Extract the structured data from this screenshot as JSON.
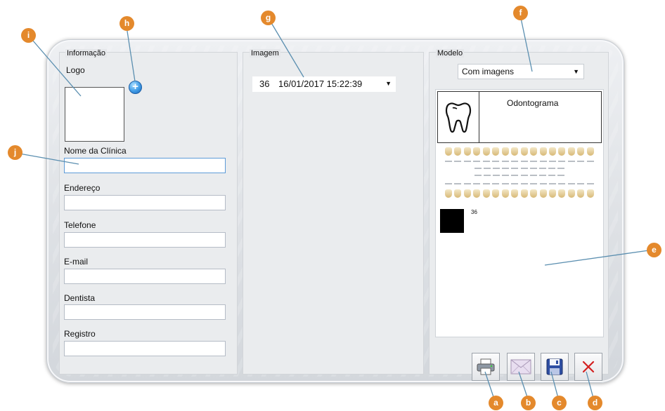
{
  "info_panel": {
    "title": "Informação",
    "logo_label": "Logo",
    "fields": [
      {
        "label": "Nome da Clínica",
        "value": ""
      },
      {
        "label": "Endereço",
        "value": ""
      },
      {
        "label": "Telefone",
        "value": ""
      },
      {
        "label": "E-mail",
        "value": ""
      },
      {
        "label": "Dentista",
        "value": ""
      },
      {
        "label": "Registro",
        "value": ""
      }
    ],
    "add_logo_icon": "plus-circle-icon"
  },
  "image_panel": {
    "title": "Imagem",
    "selected_number": "36",
    "selected_date": "16/01/2017 15:22:39"
  },
  "model_panel": {
    "title": "Modelo",
    "selected_model": "Com imagens",
    "preview": {
      "header_title": "Odontograma",
      "image_label": "36"
    },
    "buttons": [
      "print-icon",
      "email-icon",
      "save-icon",
      "close-icon"
    ]
  },
  "callouts": [
    "a",
    "b",
    "c",
    "d",
    "e",
    "f",
    "g",
    "h",
    "i",
    "j"
  ],
  "colors": {
    "callout": "#e4892c",
    "leader": "#5b8fb0",
    "close_red": "#d32020"
  }
}
